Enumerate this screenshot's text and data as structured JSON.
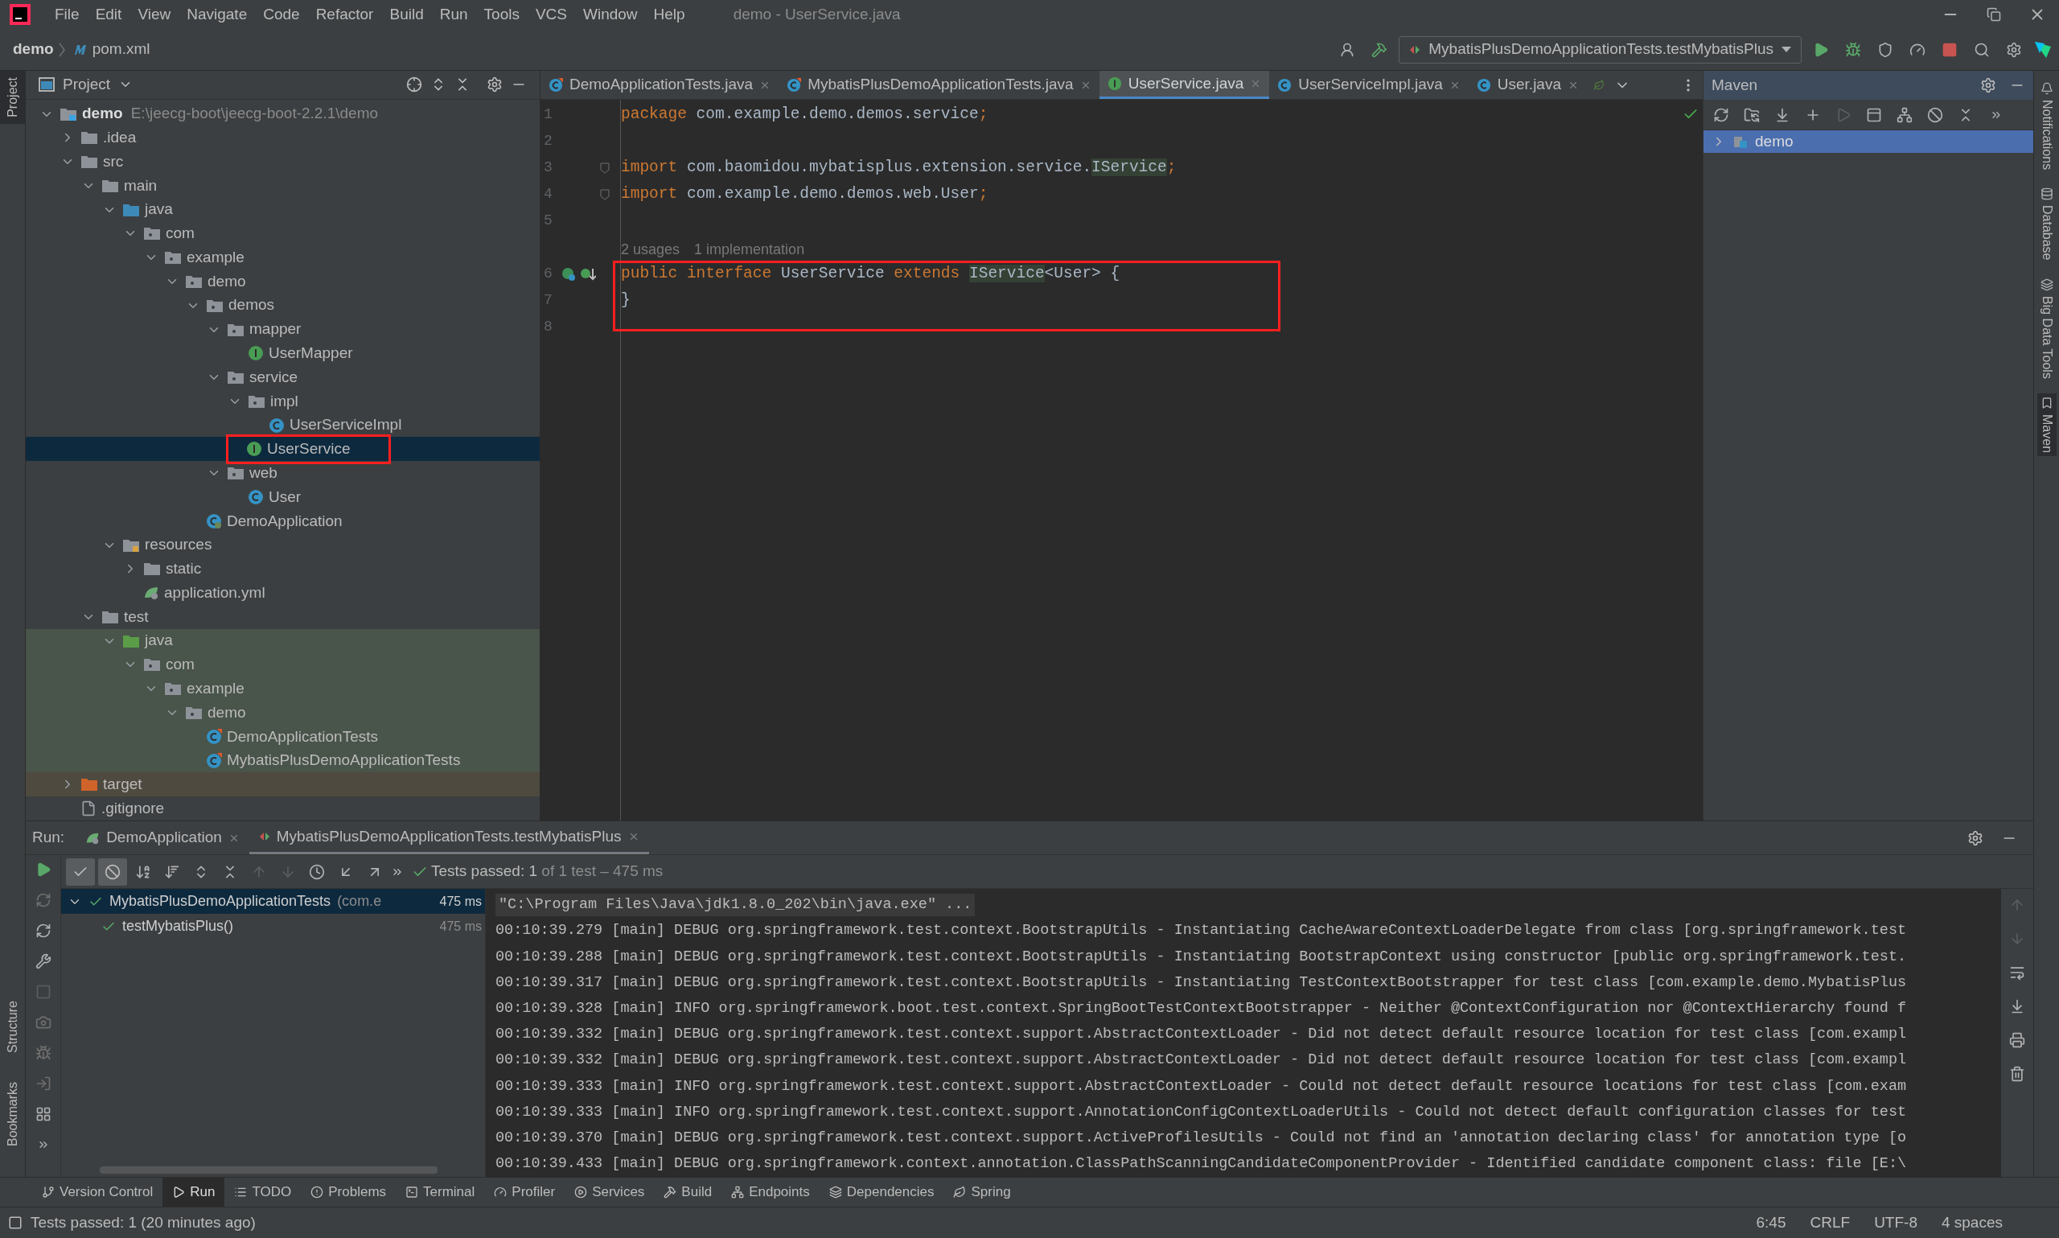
{
  "menu": [
    "File",
    "Edit",
    "View",
    "Navigate",
    "Code",
    "Refactor",
    "Build",
    "Run",
    "Tools",
    "VCS",
    "Window",
    "Help"
  ],
  "window_title": "demo - UserService.java",
  "breadcrumbs": [
    {
      "label": "demo",
      "kind": "module"
    },
    {
      "label": "pom.xml",
      "kind": "maven"
    }
  ],
  "run_config": "MybatisPlusDemoApplicationTests.testMybatisPlus",
  "left_stripe": {
    "top": [
      {
        "label": "Project",
        "selected": true
      }
    ],
    "bottom": [
      {
        "label": "Structure",
        "selected": false
      },
      {
        "label": "Bookmarks",
        "selected": false
      }
    ]
  },
  "right_stripe": [
    {
      "label": "Notifications",
      "kind": "bell",
      "selected": false
    },
    {
      "label": "Database",
      "kind": "database",
      "selected": false
    },
    {
      "label": "Big Data Tools",
      "kind": "bigdata",
      "selected": false
    },
    {
      "label": "Maven",
      "kind": "maven",
      "selected": true
    }
  ],
  "project": {
    "title": "Project",
    "tree": [
      {
        "name": "demo",
        "path": "E:\\jeecg-boot\\jeecg-boot-2.2.1\\demo",
        "kind": "module",
        "expanded": true,
        "selected": false,
        "children": [
          {
            "name": ".idea",
            "kind": "folder",
            "expanded": false,
            "selected": false
          },
          {
            "name": "src",
            "kind": "folder",
            "expanded": true,
            "selected": false,
            "children": [
              {
                "name": "main",
                "kind": "folder",
                "expanded": true,
                "selected": false,
                "children": [
                  {
                    "name": "java",
                    "kind": "source_root",
                    "expanded": true,
                    "selected": false,
                    "children": [
                      {
                        "name": "com",
                        "kind": "package",
                        "expanded": true,
                        "selected": false,
                        "children": [
                          {
                            "name": "example",
                            "kind": "package",
                            "expanded": true,
                            "selected": false,
                            "children": [
                              {
                                "name": "demo",
                                "kind": "package",
                                "expanded": true,
                                "selected": false,
                                "children": [
                                  {
                                    "name": "demos",
                                    "kind": "package",
                                    "expanded": true,
                                    "selected": false,
                                    "children": [
                                      {
                                        "name": "mapper",
                                        "kind": "package",
                                        "expanded": true,
                                        "selected": false,
                                        "children": [
                                          {
                                            "name": "UserMapper",
                                            "kind": "interface",
                                            "selected": false
                                          }
                                        ]
                                      },
                                      {
                                        "name": "service",
                                        "kind": "package",
                                        "expanded": true,
                                        "selected": false,
                                        "children": [
                                          {
                                            "name": "impl",
                                            "kind": "package",
                                            "expanded": true,
                                            "selected": false,
                                            "children": [
                                              {
                                                "name": "UserServiceImpl",
                                                "kind": "class",
                                                "selected": false
                                              }
                                            ]
                                          },
                                          {
                                            "name": "UserService",
                                            "kind": "interface",
                                            "selected": true,
                                            "boxed": true
                                          }
                                        ]
                                      },
                                      {
                                        "name": "web",
                                        "kind": "package",
                                        "expanded": true,
                                        "selected": false,
                                        "children": [
                                          {
                                            "name": "User",
                                            "kind": "class",
                                            "selected": false
                                          }
                                        ]
                                      }
                                    ]
                                  },
                                  {
                                    "name": "DemoApplication",
                                    "kind": "spring_class",
                                    "selected": false
                                  }
                                ]
                              }
                            ]
                          }
                        ]
                      }
                    ]
                  },
                  {
                    "name": "resources",
                    "kind": "resource_root",
                    "expanded": true,
                    "selected": false,
                    "children": [
                      {
                        "name": "static",
                        "kind": "folder",
                        "expanded": false,
                        "selected": false
                      },
                      {
                        "name": "application.yml",
                        "kind": "yaml",
                        "selected": false
                      }
                    ]
                  }
                ]
              },
              {
                "name": "test",
                "kind": "folder",
                "expanded": true,
                "selected": false,
                "children": [
                  {
                    "name": "java",
                    "kind": "test_root",
                    "expanded": true,
                    "selected": false,
                    "children": [
                      {
                        "name": "com",
                        "kind": "package",
                        "expanded": true,
                        "selected": false,
                        "children": [
                          {
                            "name": "example",
                            "kind": "package",
                            "expanded": true,
                            "selected": false,
                            "children": [
                              {
                                "name": "demo",
                                "kind": "package",
                                "expanded": true,
                                "selected": false,
                                "children": [
                                  {
                                    "name": "DemoApplicationTests",
                                    "kind": "test_class",
                                    "selected": false
                                  },
                                  {
                                    "name": "MybatisPlusDemoApplicationTests",
                                    "kind": "test_class",
                                    "selected": false
                                  }
                                ]
                              }
                            ]
                          }
                        ]
                      }
                    ]
                  }
                ]
              }
            ]
          },
          {
            "name": "target",
            "kind": "excluded",
            "expanded": false,
            "selected": false
          },
          {
            "name": ".gitignore",
            "kind": "file",
            "selected": false
          }
        ]
      }
    ]
  },
  "editor": {
    "tabs": [
      {
        "label": "DemoApplicationTests.java",
        "kind": "test_class",
        "selected": false
      },
      {
        "label": "MybatisPlusDemoApplicationTests.java",
        "kind": "test_class",
        "selected": false
      },
      {
        "label": "UserService.java",
        "kind": "interface",
        "selected": true
      },
      {
        "label": "UserServiceImpl.java",
        "kind": "class",
        "selected": false
      },
      {
        "label": "User.java",
        "kind": "class",
        "selected": false
      }
    ],
    "lines": [
      {
        "number": "1",
        "tokens": [
          {
            "kind": "keyword",
            "text": "package"
          },
          {
            "kind": "plain",
            "text": " com.example.demo.demos.service"
          },
          {
            "kind": "keyword",
            "text": ";"
          }
        ]
      },
      {
        "number": "2"
      },
      {
        "number": "3",
        "fold": true,
        "tokens": [
          {
            "kind": "keyword",
            "text": "import"
          },
          {
            "kind": "plain",
            "text": " com.baomidou.mybatisplus.extension.service."
          },
          {
            "kind": "usage",
            "text": "IService"
          },
          {
            "kind": "keyword",
            "text": ";"
          }
        ]
      },
      {
        "number": "4",
        "fold": true,
        "tokens": [
          {
            "kind": "keyword",
            "text": "import"
          },
          {
            "kind": "plain",
            "text": " com.example.demo.demos.web.User"
          },
          {
            "kind": "keyword",
            "text": ";"
          }
        ]
      },
      {
        "number": "5"
      },
      {
        "kind": "hint",
        "texts": [
          "2 usages",
          "1 implementation"
        ]
      },
      {
        "number": "6",
        "boxed": true,
        "gutter_icons": true,
        "tokens": [
          {
            "kind": "keyword",
            "text": "public interface"
          },
          {
            "kind": "plain",
            "text": " UserService "
          },
          {
            "kind": "keyword",
            "text": "extends "
          },
          {
            "kind": "usage",
            "text": "IService"
          },
          {
            "kind": "plain",
            "text": "<User> {"
          }
        ]
      },
      {
        "number": "7",
        "boxed": true,
        "tokens": [
          {
            "kind": "plain",
            "text": "}"
          }
        ]
      },
      {
        "number": "8"
      }
    ]
  },
  "maven": {
    "title": "Maven",
    "tree": [
      {
        "name": "demo",
        "expanded": false,
        "selected": true
      }
    ]
  },
  "run": {
    "label": "Run:",
    "tabs": [
      {
        "label": "DemoApplication",
        "kind": "spring",
        "selected": false
      },
      {
        "label": "MybatisPlusDemoApplicationTests.testMybatisPlus",
        "kind": "test",
        "selected": true
      }
    ],
    "status": {
      "main": "Tests passed: 1",
      "detail": "of 1 test – 475 ms"
    },
    "tests": [
      {
        "name": "MybatisPlusDemoApplicationTests",
        "detail": "(com.e",
        "time": "475 ms",
        "passed": true,
        "selected": true,
        "children": [
          {
            "name": "testMybatisPlus()",
            "time": "475 ms",
            "passed": true,
            "selected": false
          }
        ]
      }
    ],
    "console": [
      {
        "kind": "command",
        "text": "\"C:\\Program Files\\Java\\jdk1.8.0_202\\bin\\java.exe\" ..."
      },
      {
        "kind": "log",
        "text": "00:10:39.279 [main] DEBUG org.springframework.test.context.BootstrapUtils - Instantiating CacheAwareContextLoaderDelegate from class [org.springframework.test"
      },
      {
        "kind": "log",
        "text": "00:10:39.288 [main] DEBUG org.springframework.test.context.BootstrapUtils - Instantiating BootstrapContext using constructor [public org.springframework.test."
      },
      {
        "kind": "log",
        "text": "00:10:39.317 [main] DEBUG org.springframework.test.context.BootstrapUtils - Instantiating TestContextBootstrapper for test class [com.example.demo.MybatisPlus"
      },
      {
        "kind": "log",
        "text": "00:10:39.328 [main] INFO org.springframework.boot.test.context.SpringBootTestContextBootstrapper - Neither @ContextConfiguration nor @ContextHierarchy found f"
      },
      {
        "kind": "log",
        "text": "00:10:39.332 [main] DEBUG org.springframework.test.context.support.AbstractContextLoader - Did not detect default resource location for test class [com.exampl"
      },
      {
        "kind": "log",
        "text": "00:10:39.332 [main] DEBUG org.springframework.test.context.support.AbstractContextLoader - Did not detect default resource location for test class [com.exampl"
      },
      {
        "kind": "log",
        "text": "00:10:39.333 [main] INFO org.springframework.test.context.support.AbstractContextLoader - Could not detect default resource locations for test class [com.exam"
      },
      {
        "kind": "log",
        "text": "00:10:39.333 [main] INFO org.springframework.test.context.support.AnnotationConfigContextLoaderUtils - Could not detect default configuration classes for test"
      },
      {
        "kind": "log",
        "text": "00:10:39.370 [main] DEBUG org.springframework.test.context.support.ActiveProfilesUtils - Could not find an 'annotation declaring class' for annotation type [o"
      },
      {
        "kind": "log",
        "text": "00:10:39.433 [main] DEBUG org.springframework.context.annotation.ClassPathScanningCandidateComponentProvider - Identified candidate component class: file [E:\\"
      }
    ]
  },
  "tool_windows": [
    {
      "label": "Version Control",
      "kind": "vcs",
      "selected": false
    },
    {
      "label": "Run",
      "kind": "run",
      "selected": true
    },
    {
      "label": "TODO",
      "kind": "todo",
      "selected": false
    },
    {
      "label": "Problems",
      "kind": "problems",
      "selected": false
    },
    {
      "label": "Terminal",
      "kind": "terminal",
      "selected": false
    },
    {
      "label": "Profiler",
      "kind": "profiler",
      "selected": false
    },
    {
      "label": "Services",
      "kind": "services",
      "selected": false
    },
    {
      "label": "Build",
      "kind": "build",
      "selected": false
    },
    {
      "label": "Endpoints",
      "kind": "endpoints",
      "selected": false
    },
    {
      "label": "Dependencies",
      "kind": "dependencies",
      "selected": false
    },
    {
      "label": "Spring",
      "kind": "spring",
      "selected": false
    }
  ],
  "status_bar": {
    "message": "Tests passed: 1 (20 minutes ago)",
    "items": [
      "6:45",
      "CRLF",
      "UTF-8",
      "4 spaces"
    ]
  }
}
